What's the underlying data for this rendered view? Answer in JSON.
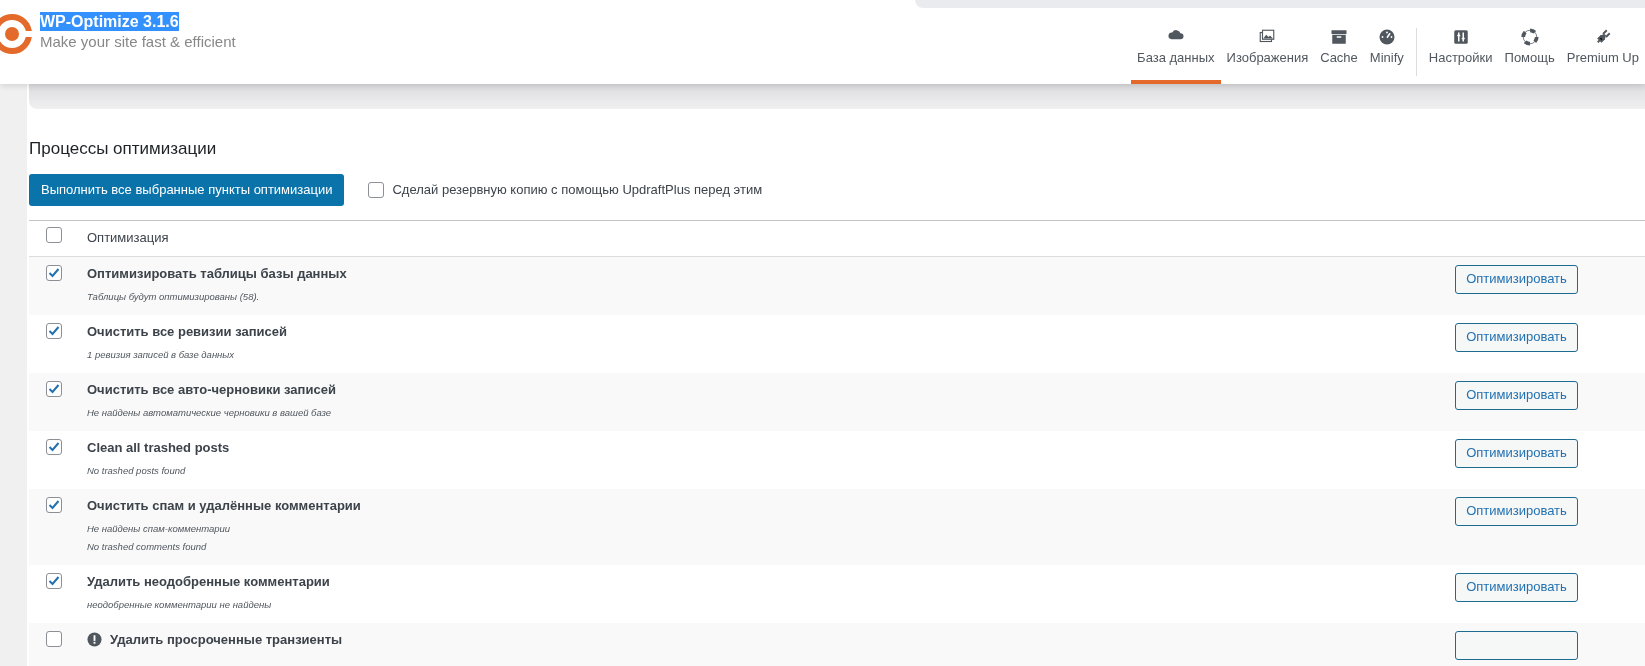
{
  "header": {
    "title": "WP-Optimize 3.1.6",
    "title_highlighted": true,
    "tagline": "Make your site fast & efficient"
  },
  "nav_groups": [
    [
      {
        "label": "База данных",
        "selected": true
      },
      {
        "label": "Изображения",
        "selected": false
      },
      {
        "label": "Cache",
        "selected": false
      },
      {
        "label": "Minify",
        "selected": false
      }
    ],
    [
      {
        "label": "Настройки",
        "selected": false
      },
      {
        "label": "Помощь",
        "selected": false
      },
      {
        "label": "Premium Up",
        "selected": false
      }
    ]
  ],
  "section_title": "Процессы оптимизации",
  "run_button": "Выполнить все выбранные пункты оптимизации",
  "backup_option": {
    "label": "Сделай резервную копию с помощью UpdraftPlus перед этим",
    "checked": false
  },
  "table": {
    "header": {
      "label": "Оптимизация",
      "checked": false
    },
    "rows": [
      {
        "title": "Оптимизировать таблицы базы данных",
        "notes": [
          "Таблицы будут оптимизированы (58)."
        ],
        "checked": true,
        "info_icon": false,
        "button": "Оптимизировать"
      },
      {
        "title": "Очистить все ревизии записей",
        "notes": [
          "1 ревизия записей в базе данных"
        ],
        "checked": true,
        "info_icon": false,
        "button": "Оптимизировать"
      },
      {
        "title": "Очистить все авто-черновики записей",
        "notes": [
          "Не найдены автоматические черновики в вашей базе"
        ],
        "checked": true,
        "info_icon": false,
        "button": "Оптимизировать"
      },
      {
        "title": "Clean all trashed posts",
        "notes": [
          "No trashed posts found"
        ],
        "checked": true,
        "info_icon": false,
        "button": "Оптимизировать"
      },
      {
        "title": "Очистить спам и удалённые комментарии",
        "notes": [
          "Не найдены спам-комментарии",
          "No trashed comments found"
        ],
        "checked": true,
        "info_icon": false,
        "button": "Оптимизировать"
      },
      {
        "title": "Удалить неодобренные комментарии",
        "notes": [
          "неодобренные комментарии не найдены"
        ],
        "checked": true,
        "info_icon": false,
        "button": "Оптимизировать"
      },
      {
        "title": "Удалить просроченные транзиенты",
        "notes": [],
        "checked": false,
        "info_icon": true
      }
    ]
  }
}
